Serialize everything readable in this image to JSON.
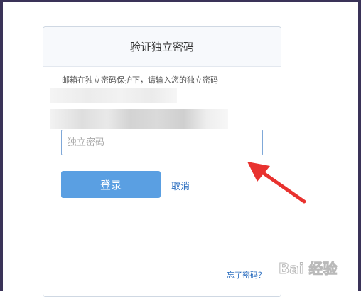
{
  "dialog": {
    "title": "验证独立密码",
    "hint": "邮箱在独立密码保护下，请输入您的独立密码",
    "password_placeholder": "独立密码",
    "password_value": "",
    "login_label": "登录",
    "cancel_label": "取消",
    "forgot_label": "忘了密码？"
  },
  "annotation": {
    "arrow_color": "#e8322f"
  },
  "watermark": {
    "text": "Bai 经验"
  },
  "colors": {
    "primary_button": "#5a9fe2",
    "link": "#2d6fc0",
    "frame": "#3a3358"
  }
}
